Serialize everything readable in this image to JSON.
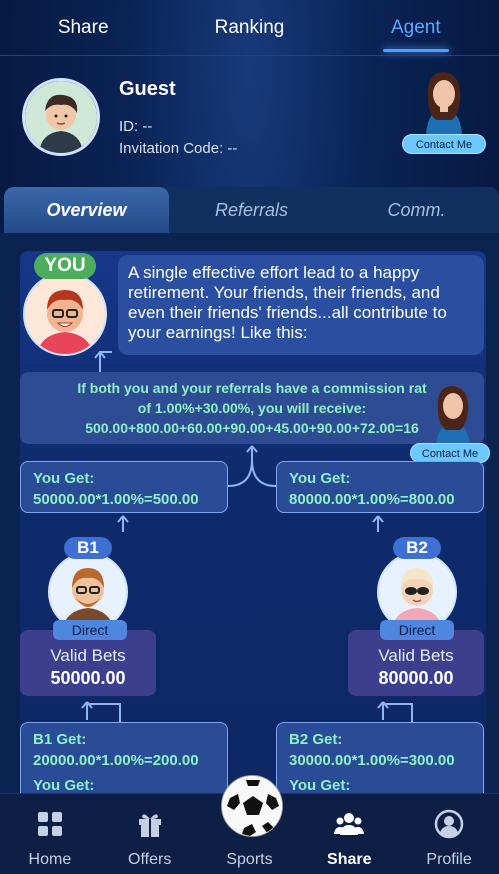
{
  "top_tabs": [
    "Share",
    "Ranking",
    "Agent"
  ],
  "profile": {
    "name": "Guest",
    "id_line": "ID: --",
    "invite_line": "Invitation Code: --",
    "contact_label": "Contact Me"
  },
  "sub_tabs": [
    "Overview",
    "Referrals",
    "Comm."
  ],
  "you_badge": "YOU",
  "intro_text": "A single effective effort lead to a happy retirement. Your friends, their friends, and even their friends' friends...all contribute to your earnings! Like this:",
  "commission": {
    "line1": "If both you and your referrals have a commission rat",
    "line2": "of 1.00%+30.00%, you will receive:",
    "line3": "500.00+800.00+60.00+90.00+45.00+90.00+72.00=16",
    "contact_label": "Contact Me"
  },
  "you_get": [
    {
      "label": "You Get:",
      "formula": "50000.00*1.00%=500.00"
    },
    {
      "label": "You Get:",
      "formula": "80000.00*1.00%=800.00"
    }
  ],
  "branches": [
    {
      "badge": "B1",
      "direct": "Direct",
      "bets_label": "Valid Bets",
      "bets_value": "50000.00"
    },
    {
      "badge": "B2",
      "direct": "Direct",
      "bets_label": "Valid Bets",
      "bets_value": "80000.00"
    }
  ],
  "sub_get": [
    {
      "label": "B1 Get:",
      "formula": "20000.00*1.00%=200.00",
      "you_label": "You Get:"
    },
    {
      "label": "B2 Get:",
      "formula": "30000.00*1.00%=300.00",
      "you_label": "You Get:"
    }
  ],
  "nav": [
    {
      "label": "Home",
      "icon": "home-grid-icon"
    },
    {
      "label": "Offers",
      "icon": "gift-icon"
    },
    {
      "label": "Sports",
      "icon": "soccer-ball-icon"
    },
    {
      "label": "Share",
      "icon": "people-icon"
    },
    {
      "label": "Profile",
      "icon": "profile-icon"
    }
  ],
  "colors": {
    "accent": "#4fa0ff",
    "highlight_text": "#8ff0c8",
    "badge_green": "#4cae5c",
    "badge_blue": "#3e6fd2"
  }
}
